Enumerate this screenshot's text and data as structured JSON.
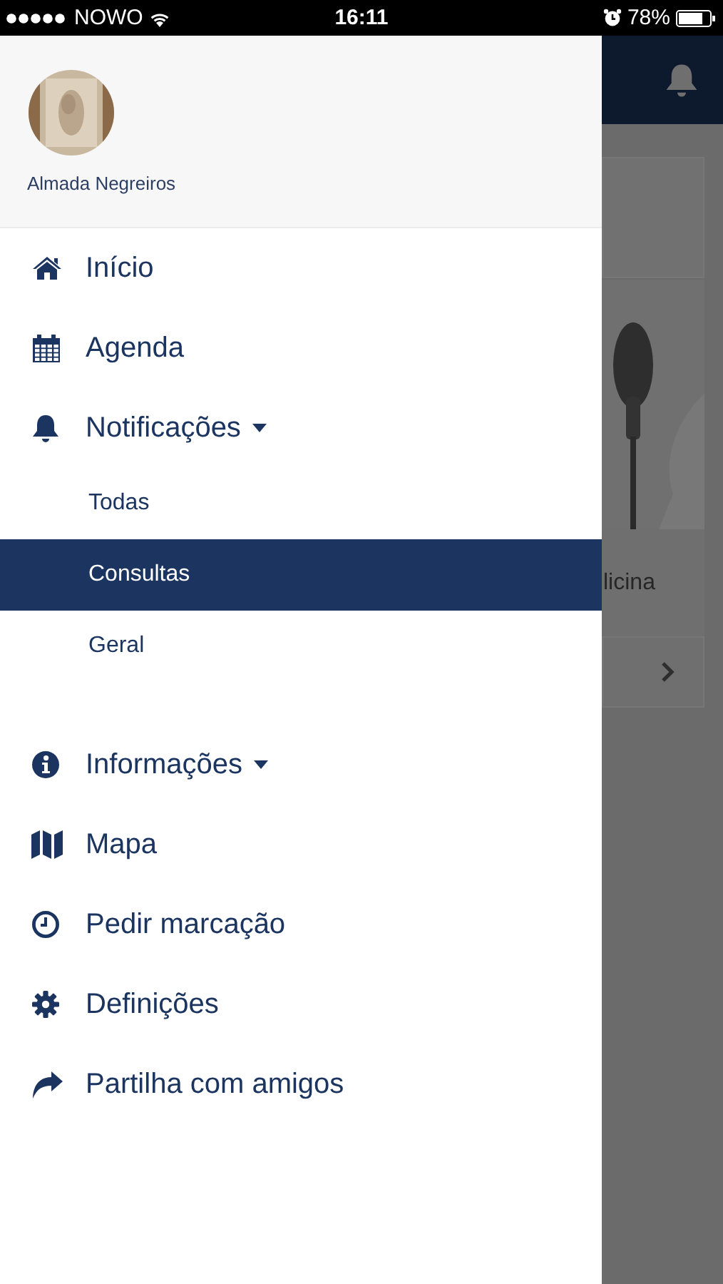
{
  "status_bar": {
    "carrier": "NOWO",
    "time": "16:11",
    "battery": "78%"
  },
  "drawer": {
    "user": {
      "name": "Almada Negreiros"
    },
    "items": [
      {
        "label": "Início",
        "dropdown": false
      },
      {
        "label": "Agenda",
        "dropdown": false
      },
      {
        "label": "Notificações",
        "dropdown": true,
        "children": [
          {
            "label": "Todas",
            "selected": false
          },
          {
            "label": "Consultas",
            "selected": true
          },
          {
            "label": "Geral",
            "selected": false
          }
        ]
      },
      {
        "label": "Informações",
        "dropdown": true
      },
      {
        "label": "Mapa",
        "dropdown": false
      },
      {
        "label": "Pedir marcação",
        "dropdown": false
      },
      {
        "label": "Definições",
        "dropdown": false
      },
      {
        "label": "Partilha com amigos",
        "dropdown": false
      }
    ]
  },
  "background": {
    "card_text": "licina"
  }
}
